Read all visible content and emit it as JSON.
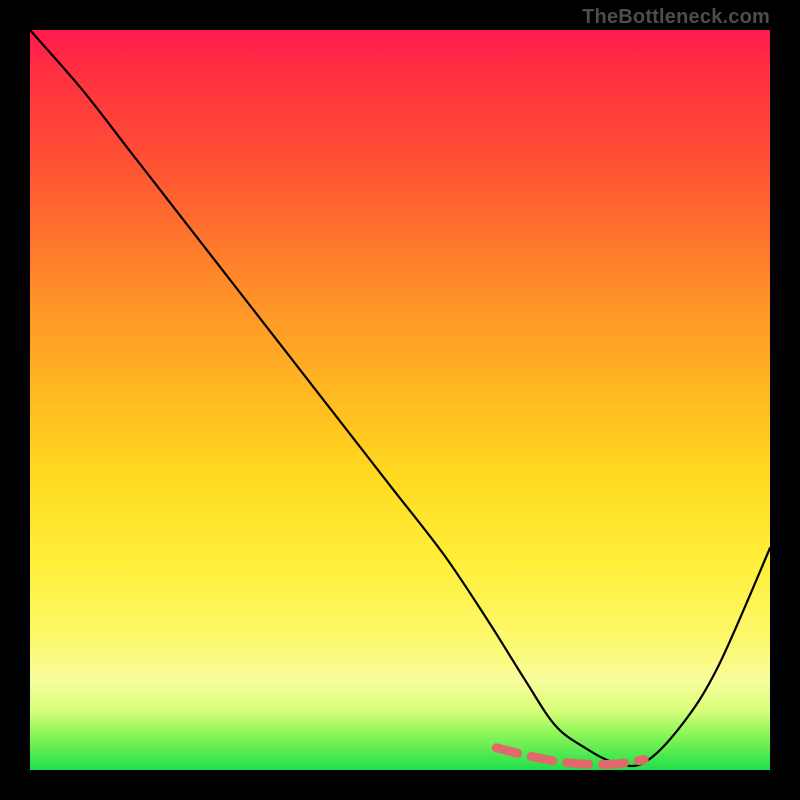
{
  "watermark": "TheBottleneck.com",
  "chart_data": {
    "type": "line",
    "title": "",
    "xlabel": "",
    "ylabel": "",
    "xlim": [
      0,
      100
    ],
    "ylim": [
      0,
      100
    ],
    "grid": false,
    "series": [
      {
        "name": "bottleneck-curve",
        "x": [
          0,
          7,
          14,
          21,
          28,
          35,
          42,
          49,
          56,
          62,
          67,
          71,
          75,
          79,
          83,
          88,
          93,
          100
        ],
        "values": [
          100,
          92,
          83,
          74,
          65,
          56,
          47,
          38,
          29,
          20,
          12,
          6,
          3,
          1,
          1,
          6,
          14,
          30
        ]
      }
    ],
    "annotations": [
      {
        "name": "optimal-zone-dash",
        "x": [
          63,
          67,
          71,
          75,
          79,
          83
        ],
        "values": [
          3,
          2,
          1.2,
          0.8,
          0.8,
          1.4
        ]
      }
    ]
  }
}
